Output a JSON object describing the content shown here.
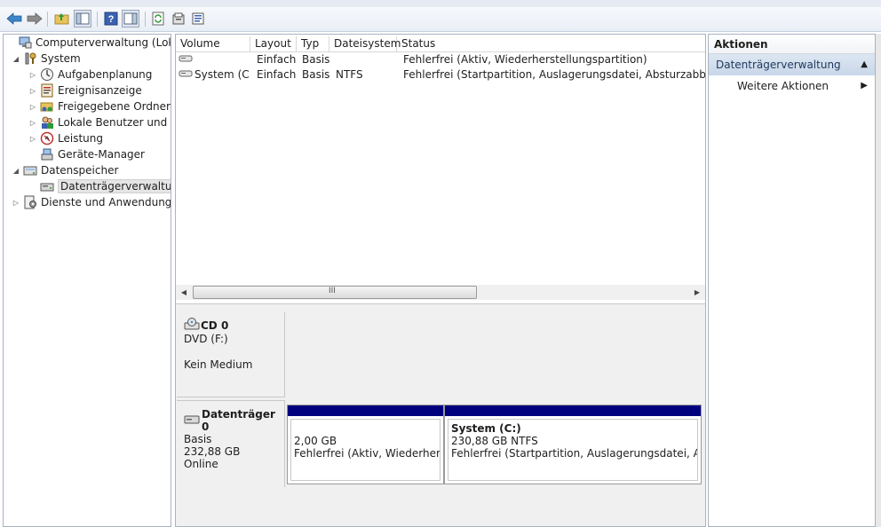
{
  "toolbar": {
    "buttons": [
      {
        "icon": "back-arrow-icon"
      },
      {
        "icon": "forward-arrow-icon"
      },
      {
        "icon": "up-folder-icon"
      },
      {
        "icon": "show-hide-console-tree-icon"
      },
      {
        "icon": "help-icon"
      },
      {
        "icon": "show-hide-action-pane-icon"
      },
      {
        "icon": "refresh-icon"
      },
      {
        "icon": "properties-icon"
      },
      {
        "icon": "export-list-icon"
      }
    ]
  },
  "tree": {
    "items": [
      {
        "label": "Computerverwaltung (Lokal)",
        "icon": "computer-management-icon",
        "expander": ""
      },
      {
        "label": "System",
        "icon": "system-tools-icon",
        "expander": "◢"
      },
      {
        "label": "Aufgabenplanung",
        "icon": "task-scheduler-icon",
        "expander": "▷"
      },
      {
        "label": "Ereignisanzeige",
        "icon": "event-viewer-icon",
        "expander": "▷"
      },
      {
        "label": "Freigegebene Ordner",
        "icon": "shared-folders-icon",
        "expander": "▷"
      },
      {
        "label": "Lokale Benutzer und Gruppen",
        "icon": "local-users-icon",
        "expander": "▷"
      },
      {
        "label": "Leistung",
        "icon": "performance-icon",
        "expander": "▷"
      },
      {
        "label": "Geräte-Manager",
        "icon": "device-manager-icon",
        "expander": ""
      },
      {
        "label": "Datenspeicher",
        "icon": "storage-icon",
        "expander": "◢"
      },
      {
        "label": "Datenträgerverwaltung",
        "icon": "disk-management-icon",
        "expander": ""
      },
      {
        "label": "Dienste und Anwendungen",
        "icon": "services-icon",
        "expander": "▷"
      }
    ]
  },
  "volumes": {
    "columns": [
      "Volume",
      "Layout",
      "Typ",
      "Dateisystem",
      "Status"
    ],
    "rows": [
      {
        "volume": "",
        "layout": "Einfach",
        "typ": "Basis",
        "fs": "",
        "status": "Fehlerfrei (Aktiv, Wiederherstellungspartition)"
      },
      {
        "volume": "System (C:)",
        "layout": "Einfach",
        "typ": "Basis",
        "fs": "NTFS",
        "status": "Fehlerfrei (Startpartition, Auslagerungsdatei, Absturzabbild, Primäre Partition)"
      }
    ],
    "scroll_grip": "III"
  },
  "disks": {
    "cd": {
      "title": "CD 0",
      "drive": "DVD (F:)",
      "media": "Kein Medium"
    },
    "disk0": {
      "title": "Datenträger 0",
      "type": "Basis",
      "size": "232,88 GB",
      "state": "Online",
      "partitions": [
        {
          "name": "",
          "size": "2,00 GB",
          "status": "Fehlerfrei (Aktiv, Wiederherstellungspartition)"
        },
        {
          "name": "System  (C:)",
          "size": "230,88 GB NTFS",
          "status": "Fehlerfrei (Startpartition, Auslagerungsdatei, Absturzabbild, Primäre Partition)"
        }
      ]
    }
  },
  "actions": {
    "header": "Aktionen",
    "section": "Datenträgerverwaltung",
    "item": "Weitere Aktionen"
  },
  "colors": {
    "partition_bar": "#00007f",
    "action_section_bg": "#c8d6e8"
  }
}
